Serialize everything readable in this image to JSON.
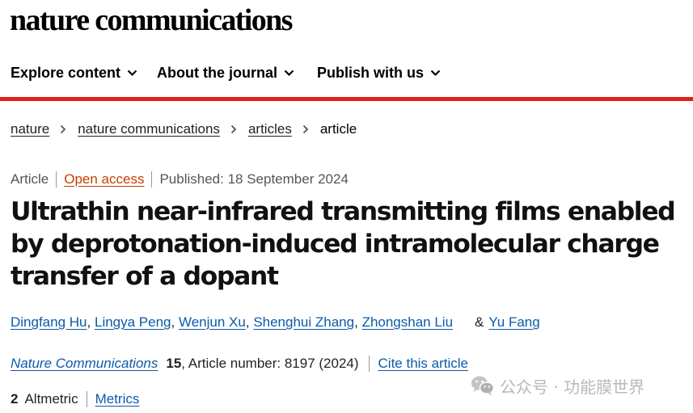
{
  "header": {
    "logo_text": "nature communications"
  },
  "nav": {
    "items": [
      {
        "label": "Explore content"
      },
      {
        "label": "About the journal"
      },
      {
        "label": "Publish with us"
      }
    ],
    "accent_color": "#e0201b"
  },
  "breadcrumb": {
    "items": [
      "nature",
      "nature communications",
      "articles"
    ],
    "current": "article"
  },
  "article": {
    "type": "Article",
    "access": "Open access",
    "published": "Published: 18 September 2024",
    "title": "Ultrathin near-infrared transmitting films enabled by deprotonation-induced intramolecular charge transfer of a dopant",
    "authors": [
      "Dingfang Hu",
      "Lingya Peng",
      "Wenjun Xu",
      "Shenghui Zhang",
      "Zhongshan Liu"
    ],
    "author_separator": ",",
    "amp": "&",
    "last_author": "Yu Fang",
    "journal": "Nature Communications",
    "volume": "15",
    "article_number_text": ", Article number: 8197 (2024)",
    "cite_label": "Cite this article",
    "altmetric_count": "2",
    "altmetric_label": "Altmetric",
    "metrics_label": "Metrics"
  },
  "watermark": {
    "text": "公众号 · 功能膜世界",
    "icon": "wechat-icon"
  },
  "colors": {
    "link": "#0c5aa8",
    "open_access": "#c63f00",
    "accent": "#e0201b"
  }
}
